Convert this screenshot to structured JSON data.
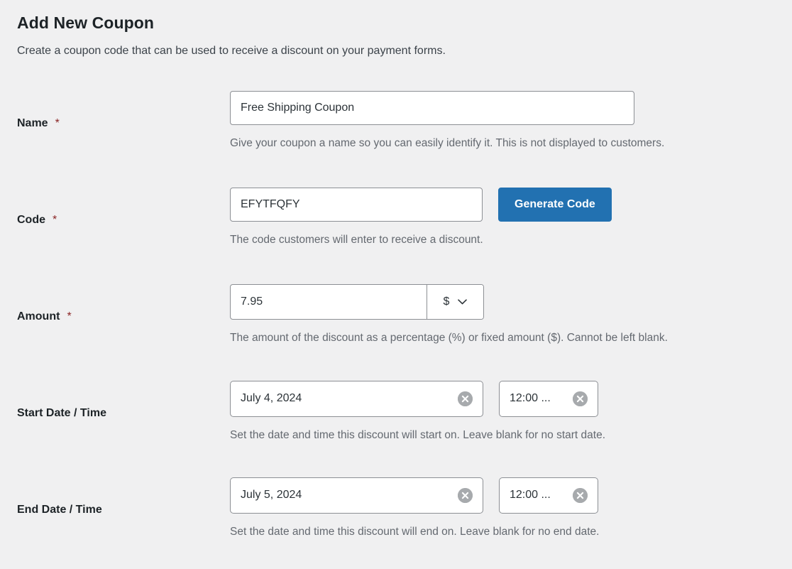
{
  "header": {
    "title": "Add New Coupon",
    "subtitle": "Create a coupon code that can be used to receive a discount on your payment forms."
  },
  "colors": {
    "background": "#f0f0f1",
    "primary_button": "#2271b1",
    "required_asterisk": "#8a2424",
    "help_text": "#646970",
    "input_border": "#8c8f94",
    "clear_icon": "#a7aaad"
  },
  "fields": {
    "name": {
      "label": "Name",
      "required_marker": "*",
      "value": "Free Shipping Coupon",
      "placeholder": "",
      "help": "Give your coupon a name so you can easily identify it. This is not displayed to customers."
    },
    "code": {
      "label": "Code",
      "required_marker": "*",
      "value": "EFYTFQFY",
      "placeholder": "",
      "help": "The code customers will enter to receive a discount.",
      "generate_button": "Generate Code"
    },
    "amount": {
      "label": "Amount",
      "required_marker": "*",
      "value": "7.95",
      "placeholder": "",
      "currency_selected": "$",
      "currency_options": [
        "$",
        "%"
      ],
      "help": "The amount of the discount as a percentage (%) or fixed amount ($). Cannot be left blank."
    },
    "start_date": {
      "label": "Start Date / Time",
      "date_value": "July 4, 2024",
      "time_value": "12:00 ...",
      "help": "Set the date and time this discount will start on. Leave blank for no start date."
    },
    "end_date": {
      "label": "End Date / Time",
      "date_value": "July 5, 2024",
      "time_value": "12:00 ...",
      "help": "Set the date and time this discount will end on. Leave blank for no end date."
    }
  },
  "icons": {
    "chevron_down": "chevron-down-icon",
    "clear": "clear-circle-icon"
  }
}
